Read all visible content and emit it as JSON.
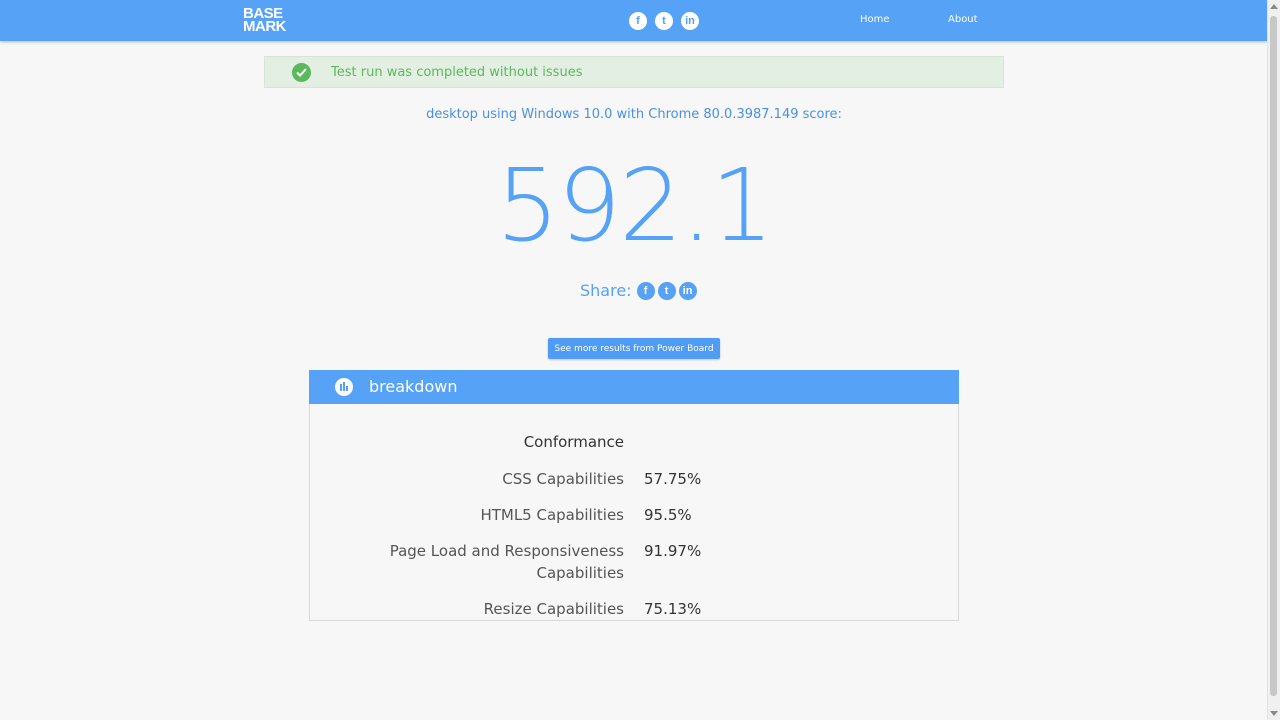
{
  "header": {
    "logo_line1": "BASE",
    "logo_line2": "MARK",
    "social": [
      {
        "icon": "facebook-icon",
        "glyph": "f"
      },
      {
        "icon": "twitter-icon",
        "glyph": "t"
      },
      {
        "icon": "linkedin-icon",
        "glyph": "in"
      }
    ],
    "nav": {
      "home": "Home",
      "about": "About"
    }
  },
  "alert": {
    "text": "Test run was completed without issues",
    "color": "#5cb85c"
  },
  "result": {
    "subtitle": "desktop using Windows 10.0 with Chrome 80.0.3987.149 score:",
    "score": "592.1"
  },
  "share": {
    "label": "Share:"
  },
  "powerboard_button": "See more results from Power Board",
  "breakdown": {
    "title": "breakdown",
    "section": "Conformance",
    "rows": [
      {
        "label": "CSS Capabilities",
        "value": "57.75%"
      },
      {
        "label": "HTML5 Capabilities",
        "value": "95.5%"
      },
      {
        "label": "Page Load and Responsiveness Capabilities",
        "value": "91.97%"
      },
      {
        "label": "Resize Capabilities",
        "value": "75.13%"
      }
    ]
  },
  "colors": {
    "accent": "#55a2f6",
    "success": "#5cb85c",
    "background": "#f7f7f7"
  }
}
